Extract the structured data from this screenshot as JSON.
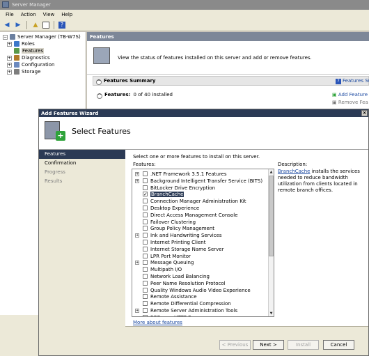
{
  "window": {
    "title": "Server Manager"
  },
  "menu": {
    "items": [
      "File",
      "Action",
      "View",
      "Help"
    ]
  },
  "toolbar": {
    "icons": [
      "back-arrow-icon",
      "forward-arrow-icon",
      "up-folder-icon",
      "show-hide-tree-icon",
      "help-icon"
    ]
  },
  "tree": {
    "items": [
      {
        "label": "Server Manager (TB-W7S)",
        "indent": 0,
        "expander": "−",
        "selected": false
      },
      {
        "label": "Roles",
        "indent": 1,
        "expander": "+",
        "selected": false
      },
      {
        "label": "Features",
        "indent": 1,
        "expander": "",
        "selected": true
      },
      {
        "label": "Diagnostics",
        "indent": 1,
        "expander": "+",
        "selected": false
      },
      {
        "label": "Configuration",
        "indent": 1,
        "expander": "+",
        "selected": false
      },
      {
        "label": "Storage",
        "indent": 1,
        "expander": "+",
        "selected": false
      }
    ]
  },
  "right": {
    "header": "Features",
    "description": "View the status of features installed on this server and add or remove features.",
    "summary_title": "Features Summary",
    "summary_help": "Features Su",
    "features_label": "Features:",
    "features_status": "0 of 40 installed",
    "action_add": "Add Feature",
    "action_remove": "Remove Fea"
  },
  "wizard": {
    "title": "Add Features Wizard",
    "close": "×",
    "heading": "Select Features",
    "steps": [
      {
        "label": "Features",
        "state": "active"
      },
      {
        "label": "Confirmation",
        "state": "normal"
      },
      {
        "label": "Progress",
        "state": "dim"
      },
      {
        "label": "Results",
        "state": "dim"
      }
    ],
    "intro": "Select one or more features to install on this server.",
    "features_label": "Features:",
    "features": [
      {
        "label": ".NET Framework 3.5.1 Features",
        "expandable": true,
        "checked": false,
        "selected": false
      },
      {
        "label": "Background Intelligent Transfer Service (BITS)",
        "expandable": true,
        "checked": false,
        "selected": false
      },
      {
        "label": "BitLocker Drive Encryption",
        "expandable": false,
        "checked": false,
        "selected": false
      },
      {
        "label": "BranchCache",
        "expandable": false,
        "checked": true,
        "selected": true
      },
      {
        "label": "Connection Manager Administration Kit",
        "expandable": false,
        "checked": false,
        "selected": false
      },
      {
        "label": "Desktop Experience",
        "expandable": false,
        "checked": false,
        "selected": false
      },
      {
        "label": "Direct Access Management Console",
        "expandable": false,
        "checked": false,
        "selected": false
      },
      {
        "label": "Failover Clustering",
        "expandable": false,
        "checked": false,
        "selected": false
      },
      {
        "label": "Group Policy Management",
        "expandable": false,
        "checked": false,
        "selected": false
      },
      {
        "label": "Ink and Handwriting Services",
        "expandable": true,
        "checked": false,
        "selected": false
      },
      {
        "label": "Internet Printing Client",
        "expandable": false,
        "checked": false,
        "selected": false
      },
      {
        "label": "Internet Storage Name Server",
        "expandable": false,
        "checked": false,
        "selected": false
      },
      {
        "label": "LPR Port Monitor",
        "expandable": false,
        "checked": false,
        "selected": false
      },
      {
        "label": "Message Queuing",
        "expandable": true,
        "checked": false,
        "selected": false
      },
      {
        "label": "Multipath I/O",
        "expandable": false,
        "checked": false,
        "selected": false
      },
      {
        "label": "Network Load Balancing",
        "expandable": false,
        "checked": false,
        "selected": false
      },
      {
        "label": "Peer Name Resolution Protocol",
        "expandable": false,
        "checked": false,
        "selected": false
      },
      {
        "label": "Quality Windows Audio Video Experience",
        "expandable": false,
        "checked": false,
        "selected": false
      },
      {
        "label": "Remote Assistance",
        "expandable": false,
        "checked": false,
        "selected": false
      },
      {
        "label": "Remote Differential Compression",
        "expandable": false,
        "checked": false,
        "selected": false
      },
      {
        "label": "Remote Server Administration Tools",
        "expandable": true,
        "checked": false,
        "selected": false
      },
      {
        "label": "RPC over HTTP Proxy",
        "expandable": false,
        "checked": false,
        "selected": false
      }
    ],
    "more_link": "More about features",
    "description_label": "Description:",
    "description_link": "BranchCache",
    "description_text": " installs the services needed to reduce bandwidth utilization from clients located in remote branch offices.",
    "buttons": {
      "previous": "< Previous",
      "next": "Next >",
      "install": "Install",
      "cancel": "Cancel"
    }
  }
}
